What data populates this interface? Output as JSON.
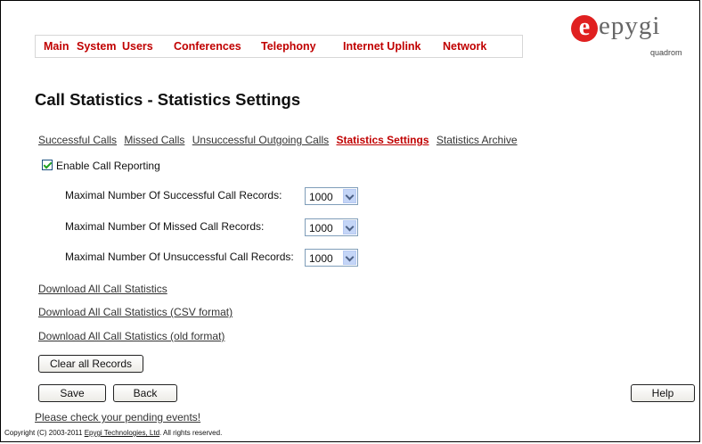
{
  "nav": {
    "items": [
      "Main",
      "System",
      "Users",
      "Conferences",
      "Telephony",
      "Internet Uplink",
      "Network"
    ]
  },
  "logo": {
    "mark": "e",
    "word": "epygi",
    "sub": "quadrom",
    "color": "#e02020"
  },
  "page": {
    "title": "Call Statistics - Statistics Settings"
  },
  "tabs": [
    {
      "label": "Successful Calls"
    },
    {
      "label": "Missed Calls"
    },
    {
      "label": "Unsuccessful Outgoing Calls"
    },
    {
      "label": "Statistics Settings"
    },
    {
      "label": "Statistics Archive"
    }
  ],
  "settings": {
    "enable_label": "Enable Call Reporting",
    "enable_checked": true,
    "rows": [
      {
        "label": "Maximal Number Of Successful Call Records:",
        "value": "1000"
      },
      {
        "label": "Maximal Number Of Missed Call Records:",
        "value": "1000"
      },
      {
        "label": "Maximal Number Of Unsuccessful Call Records:",
        "value": "1000"
      }
    ]
  },
  "downloads": [
    "Download All Call Statistics",
    "Download All Call Statistics (CSV format)",
    "Download All Call Statistics (old format)"
  ],
  "buttons": {
    "clear": "Clear all Records",
    "save": "Save",
    "back": "Back",
    "help": "Help"
  },
  "footer": {
    "pending": "Please check your pending events!",
    "copyright_prefix": "Copyright (C) 2003-2011 ",
    "company": "Epygi Technologies, Ltd",
    "copyright_suffix": ". All rights reserved."
  },
  "colors": {
    "accent": "#c00000"
  }
}
